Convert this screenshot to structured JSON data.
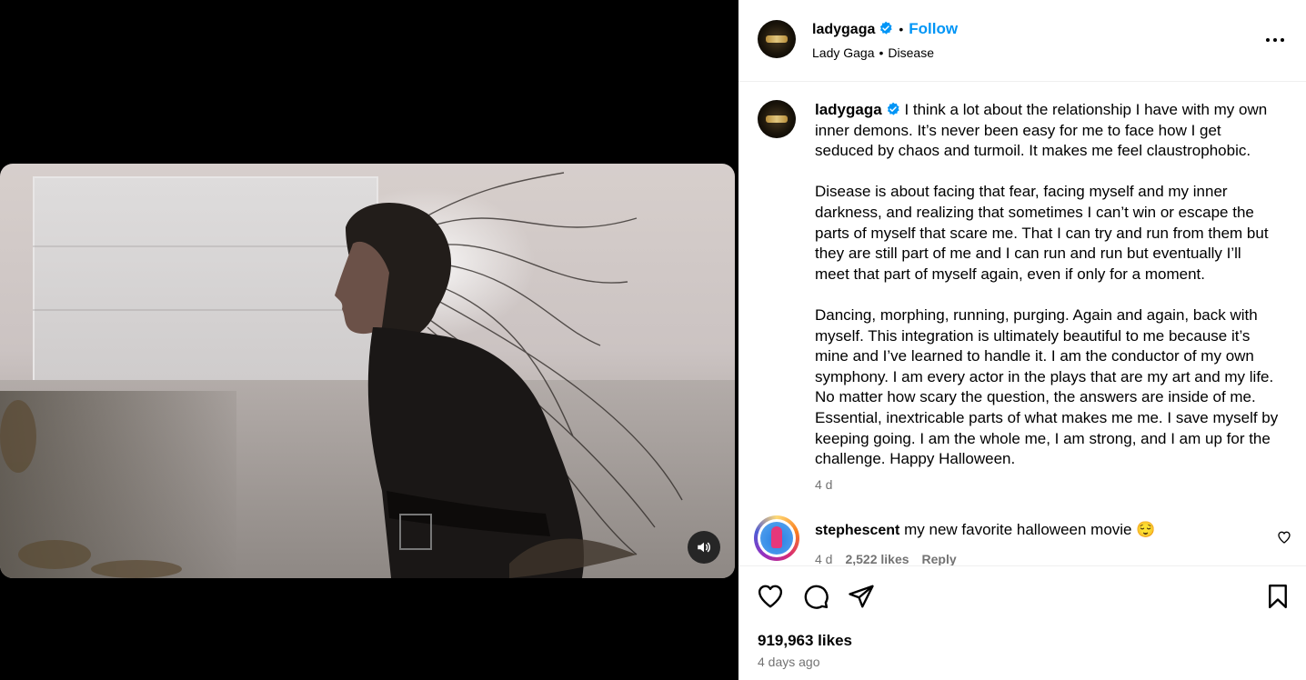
{
  "post": {
    "username": "ladygaga",
    "follow_label": "Follow",
    "header_subtitle_artist": "Lady Gaga",
    "header_subtitle_song": "Disease",
    "caption": "I think a lot about the relationship I have with my own inner demons. It’s never been easy for me to face how I get seduced by chaos and turmoil. It makes me feel claustrophobic.\n\nDisease is about facing that fear, facing myself and my inner darkness, and realizing that sometimes I can’t win or escape the parts of myself that scare me. That I can try and run from them but they are still part of me and I can run and run but eventually I’ll meet that part of myself again, even if only for a moment.\n\nDancing, morphing, running, purging. Again and again, back with myself. This integration is ultimately beautiful to me because it’s mine and I’ve learned to handle it. I am the conductor of my own symphony. I am every actor in the plays that are my art and my life. No matter how scary the question, the answers are inside of me. Essential, inextricable parts of what makes me me. I save myself by keeping going. I am the whole me, I am strong, and I am up for the challenge. Happy Halloween.",
    "caption_time": "4 d",
    "likes": "919,963 likes",
    "date": "4 days ago"
  },
  "comment": {
    "username": "stephescent",
    "text": "my new favorite halloween movie 😌",
    "time": "4 d",
    "likes": "2,522 likes",
    "reply_label": "Reply"
  },
  "icons": {
    "verified": "verified-badge-icon",
    "more": "more-options-icon",
    "mute": "speaker-icon",
    "like": "heart-icon",
    "comment": "comment-bubble-icon",
    "share": "paper-plane-icon",
    "save": "bookmark-icon"
  },
  "colors": {
    "accent": "#0095f6",
    "verified": "#0095f6",
    "secondary_text": "#737373"
  }
}
